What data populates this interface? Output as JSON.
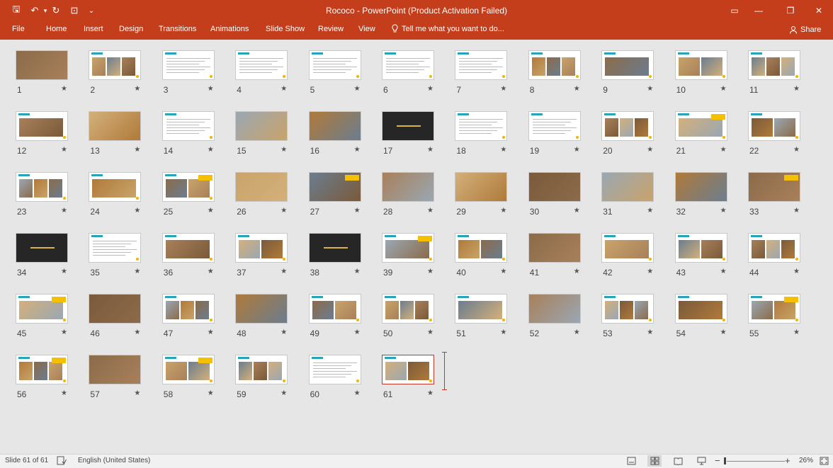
{
  "window": {
    "title": "Rococo - PowerPoint (Product Activation Failed)",
    "qat": [
      {
        "name": "save-icon",
        "glyph": "🖫"
      },
      {
        "name": "undo-icon",
        "glyph": "↶"
      },
      {
        "name": "undo-dropdown-icon",
        "glyph": "▾"
      },
      {
        "name": "redo-icon",
        "glyph": "↻"
      },
      {
        "name": "start-from-beginning-icon",
        "glyph": "⊡"
      },
      {
        "name": "customize-qat-icon",
        "glyph": "⌄"
      }
    ],
    "controls": [
      {
        "name": "ribbon-display-options-icon",
        "glyph": "▭"
      },
      {
        "name": "minimize-icon",
        "glyph": "—"
      },
      {
        "name": "restore-icon",
        "glyph": "❐"
      },
      {
        "name": "close-icon",
        "glyph": "✕"
      }
    ]
  },
  "ribbon": {
    "tabs": [
      "File",
      "Home",
      "Insert",
      "Design",
      "Transitions",
      "Animations",
      "Slide Show",
      "Review",
      "View"
    ],
    "tell_me": "Tell me what you want to do...",
    "tell_me_icon": "lightbulb-icon",
    "share": "Share",
    "share_icon": "person-icon"
  },
  "slides": {
    "count": 61,
    "selected": 61,
    "star_glyph": "★",
    "labels": [
      "1",
      "2",
      "3",
      "4",
      "5",
      "6",
      "7",
      "8",
      "9",
      "10",
      "11",
      "12",
      "13",
      "14",
      "15",
      "16",
      "17",
      "18",
      "19",
      "20",
      "21",
      "22",
      "23",
      "24",
      "25",
      "26",
      "27",
      "28",
      "29",
      "30",
      "31",
      "32",
      "33",
      "34",
      "35",
      "36",
      "37",
      "38",
      "39",
      "40",
      "41",
      "42",
      "43",
      "44",
      "45",
      "46",
      "47",
      "48",
      "49",
      "50",
      "51",
      "52",
      "53",
      "54",
      "55",
      "56",
      "57",
      "58",
      "59",
      "60",
      "61"
    ]
  },
  "status": {
    "slide_info": "Slide 61 of 61",
    "language": "English (United States)",
    "zoom": "26%",
    "zoom_minus": "−",
    "zoom_plus": "+"
  },
  "colors": {
    "ribbon": "#c43e1c",
    "accent_teal": "#29a3b8",
    "accent_yellow": "#f5c000",
    "dark_slide": "#262626"
  }
}
